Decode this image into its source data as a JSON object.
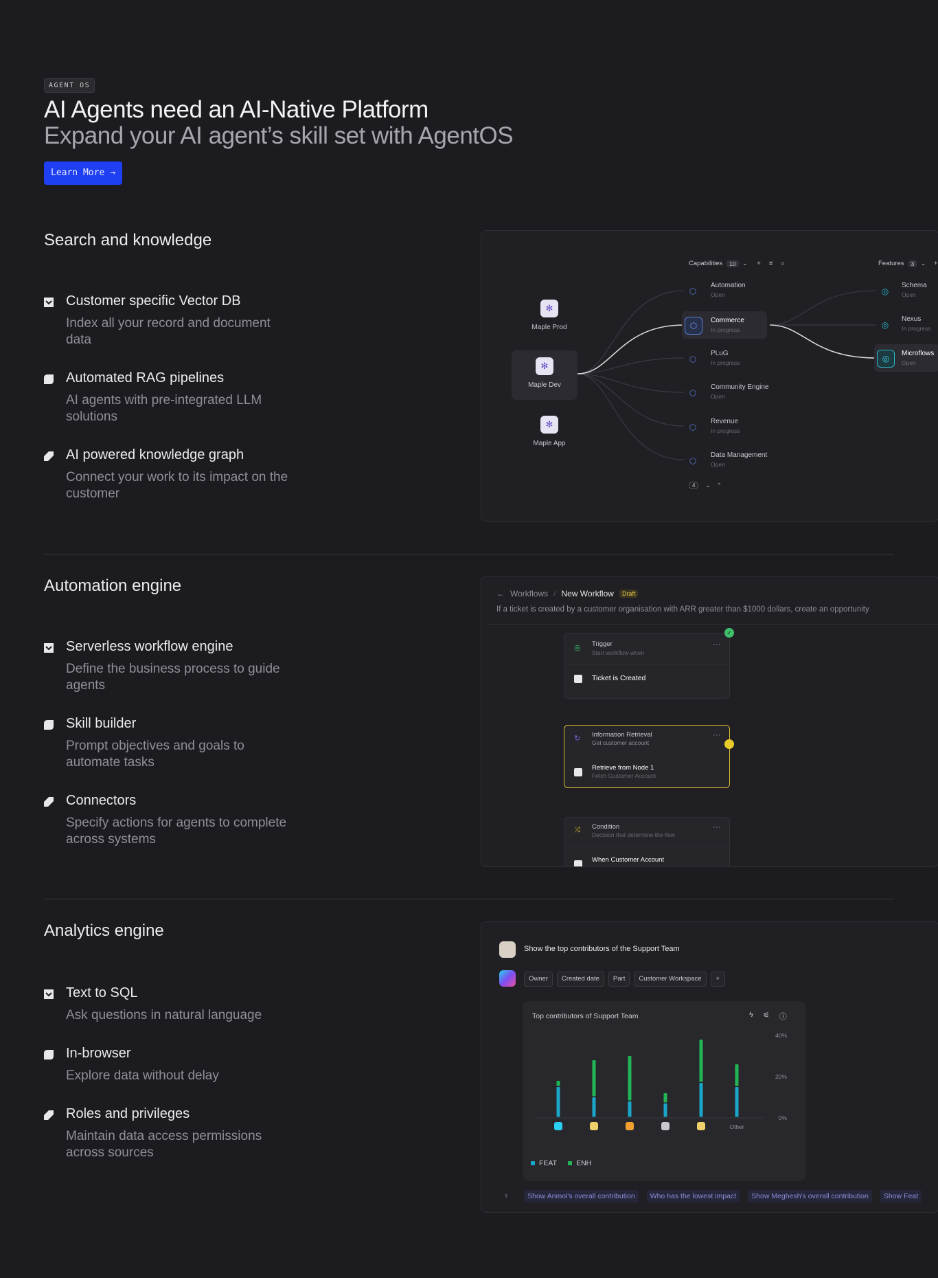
{
  "hero": {
    "eyebrow": "AGENT OS",
    "title": "AI Agents need an AI-Native Platform",
    "subtitle": "Expand your AI agent’s skill set with AgentOS",
    "cta_label": "Learn More"
  },
  "sections": [
    {
      "title": "Search and knowledge",
      "features": [
        {
          "title": "Customer specific Vector DB",
          "desc": "Index all your record and document data"
        },
        {
          "title": "Automated RAG pipelines",
          "desc": "AI agents with pre-integrated LLM solutions"
        },
        {
          "title": "AI powered knowledge graph",
          "desc": "Connect your work to its impact on the customer"
        }
      ]
    },
    {
      "title": "Automation engine",
      "features": [
        {
          "title": "Serverless workflow engine",
          "desc": "Define the business process to guide agents"
        },
        {
          "title": "Skill builder",
          "desc": "Prompt objectives and goals to automate tasks"
        },
        {
          "title": "Connectors",
          "desc": "Specify actions for agents to complete across systems"
        }
      ]
    },
    {
      "title": "Analytics engine",
      "features": [
        {
          "title": "Text to SQL",
          "desc": "Ask questions in natural language"
        },
        {
          "title": "In-browser",
          "desc": "Explore data without delay"
        },
        {
          "title": "Roles and privileges",
          "desc": "Maintain data access permissions across sources"
        }
      ]
    }
  ],
  "graph": {
    "capabilities_label": "Capabilities",
    "capabilities_count": "10",
    "features_label": "Features",
    "features_count": "3",
    "products": [
      "Maple Prod",
      "Maple Dev",
      "Maple App"
    ],
    "capabilities": [
      {
        "name": "Automation",
        "status": "Open"
      },
      {
        "name": "Commerce",
        "status": "In progress"
      },
      {
        "name": "PLuG",
        "status": "In progress"
      },
      {
        "name": "Community Engine",
        "status": "Open"
      },
      {
        "name": "Revenue",
        "status": "In progress"
      },
      {
        "name": "Data Management",
        "status": "Open"
      }
    ],
    "features": [
      {
        "name": "Schema",
        "status": "Open"
      },
      {
        "name": "Nexus",
        "status": "In progress"
      },
      {
        "name": "Microflows",
        "status": "Open"
      }
    ],
    "more_count": "4"
  },
  "workflow": {
    "breadcrumb_root": "Workflows",
    "breadcrumb_current": "New Workflow",
    "badge": "Draft",
    "prompt": "If a ticket is created by a customer organisation with ARR greater than $1000 dollars, create an opportunity",
    "trigger": {
      "title": "Trigger",
      "sub": "Start workflow when",
      "action": "Ticket is Created"
    },
    "info": {
      "title": "Information Retrieval",
      "sub": "Get customer account",
      "action": "Retrieve from Node 1",
      "action_sub": "Fetch Customer Account"
    },
    "condition": {
      "title": "Condition",
      "sub": "Decision that determine the flow",
      "action": "When Customer Account"
    }
  },
  "analytics": {
    "query": "Show the top contributors of the Support Team",
    "filters": [
      "Owner",
      "Created date",
      "Part",
      "Customer Workspace"
    ],
    "chart_title": "Top contributors of Support Team",
    "suggestions": [
      "Show Anmol's overall contribution",
      "Who has the lowest impact",
      "Show Meghesh's overall contribution",
      "Show Feat"
    ]
  },
  "chart_data": {
    "type": "bar",
    "title": "Top contributors of Support Team",
    "categories": [
      "",
      "",
      "",
      "",
      "",
      "Other"
    ],
    "series": [
      {
        "name": "FEAT",
        "values": [
          15,
          10,
          8,
          7,
          17,
          15
        ],
        "color": "#1ba6c9"
      },
      {
        "name": "ENH",
        "values": [
          3,
          18,
          22,
          5,
          21,
          11
        ],
        "color": "#22b455"
      }
    ],
    "stacked": true,
    "ylim": [
      0,
      40
    ],
    "yticks": [
      "40%",
      "20%",
      "0%"
    ],
    "legend": "bottom-left"
  }
}
